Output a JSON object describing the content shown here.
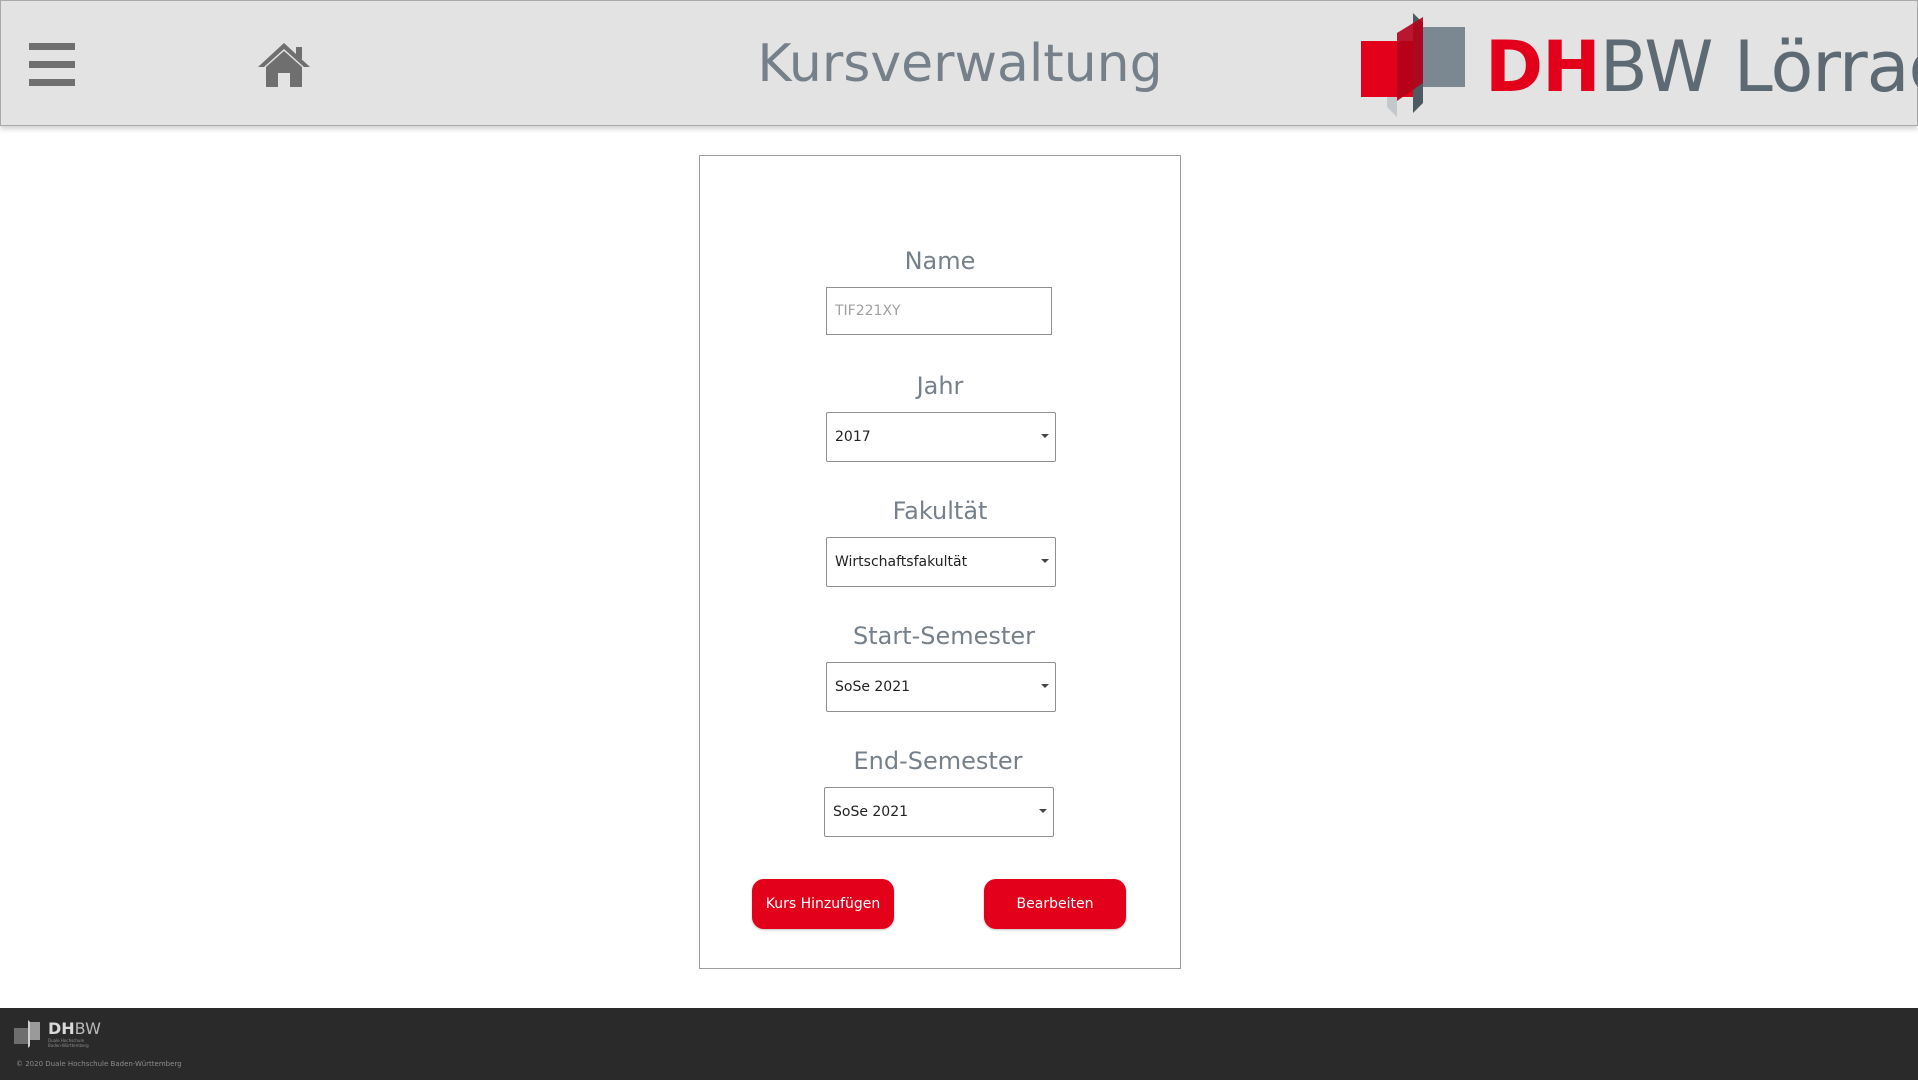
{
  "header": {
    "title": "Kursverwaltung",
    "menu_icon": "hamburger-menu-icon",
    "home_icon": "home-icon",
    "logo": {
      "text_bold": "DH",
      "text_rest": "BW Lörrach",
      "colors": {
        "red": "#e2001a",
        "grey": "#5d6a73"
      }
    }
  },
  "form": {
    "name": {
      "label": "Name",
      "placeholder": "TIF221XY",
      "value": ""
    },
    "year": {
      "label": "Jahr",
      "value": "2017"
    },
    "faculty": {
      "label": "Fakultät",
      "value": "Wirtschaftsfakultät"
    },
    "start_semester": {
      "label": "Start-Semester",
      "value": "SoSe 2021"
    },
    "end_semester": {
      "label": "End-Semester",
      "value": "SoSe 2021"
    },
    "add_button": "Kurs Hinzufügen",
    "edit_button": "Bearbeiten"
  },
  "footer": {
    "logo_bold": "DH",
    "logo_rest": "BW",
    "logo_sub": "Duale Hochschule\nBaden-Württemberg",
    "copyright": "© 2020 Duale Hochschule Baden-Württemberg"
  },
  "colors": {
    "accent": "#e2001a",
    "header_bg": "#e3e3e3",
    "footer_bg": "#2a2a2a",
    "label_text": "#76808a"
  }
}
